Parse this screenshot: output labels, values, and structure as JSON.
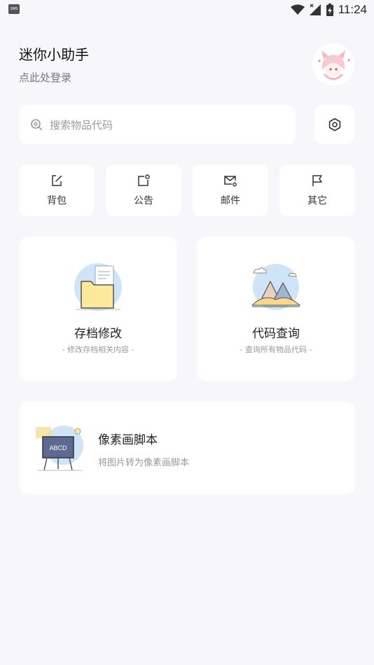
{
  "status_bar": {
    "time": "11:24",
    "notification_icon": "sms-icon",
    "notification_text": "SMS",
    "icons": [
      "wifi-icon",
      "signal-icon",
      "battery-charging-icon"
    ]
  },
  "header": {
    "title": "迷你小助手",
    "subtitle": "点此处登录",
    "avatar": "anime-avatar"
  },
  "search": {
    "placeholder": "搜索物品代码",
    "icon": "search-icon",
    "settings_icon": "settings-icon"
  },
  "quick_actions": [
    {
      "label": "背包",
      "icon": "edit-square-icon"
    },
    {
      "label": "公告",
      "icon": "notification-square-icon"
    },
    {
      "label": "邮件",
      "icon": "mail-settings-icon"
    },
    {
      "label": "其它",
      "icon": "flag-icon"
    }
  ],
  "feature_cards": [
    {
      "title": "存档修改",
      "subtitle": "- 修改存档相关内容 -",
      "illustration": "folder-illustration"
    },
    {
      "title": "代码查询",
      "subtitle": "- 查询所有物品代码 -",
      "illustration": "mountain-illustration"
    }
  ],
  "pixel_card": {
    "title": "像素画脚本",
    "subtitle": "将图片转为像素画脚本",
    "illustration": "easel-illustration",
    "board_text": "ABCD"
  },
  "colors": {
    "background": "#f7f7fb",
    "card": "#ffffff",
    "folder_yellow": "#fde99a",
    "illustration_blue": "#cfe4f7"
  }
}
